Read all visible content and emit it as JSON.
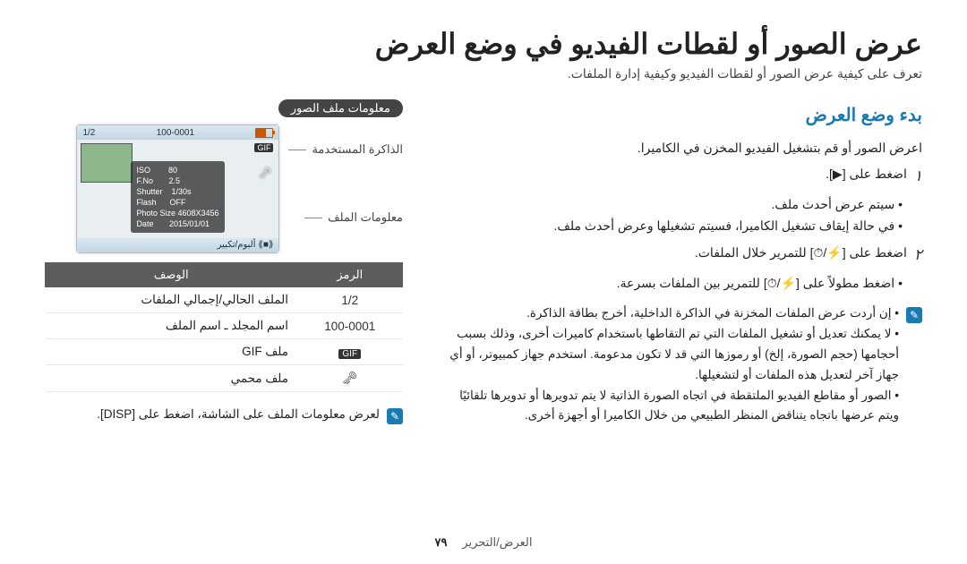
{
  "page": {
    "title": "عرض الصور أو لقطات الفيديو في وضع العرض",
    "intro": "تعرف على كيفية عرض الصور أو لقطات الفيديو وكيفية إدارة الملفات."
  },
  "playback": {
    "heading": "بدء وضع العرض",
    "lead": "اعرض الصور أو قم بتشغيل الفيديو المخزن في الكاميرا.",
    "step1": {
      "num": "١",
      "text": "اضغط على [▶]."
    },
    "step1_bullets": [
      "سيتم عرض أحدث ملف.",
      "في حالة إيقاف تشغيل الكاميرا، فسيتم تشغيلها وعرض أحدث ملف."
    ],
    "step2": {
      "num": "٢",
      "text": "اضغط على [⚡/⏱] للتمرير خلال الملفات."
    },
    "step2_bullets": [
      "اضغط مطولاً على [⚡/⏱] للتمرير بين الملفات بسرعة."
    ],
    "notes": [
      "إن أردت عرض الملفات المخزنة في الذاكرة الداخلية، أخرج بطاقة الذاكرة.",
      "لا يمكنك تعديل أو تشغيل الملفات التي تم التقاطها باستخدام كاميرات أخرى، وذلك بسبب أحجامها (حجم الصورة، إلخ) أو رموزها التي قد لا تكون مدعومة. استخدم جهاز كمبيوتر، أو أي جهاز آخر لتعديل هذه الملفات أو لتشغيلها.",
      "الصور أو مقاطع الفيديو الملتقطة في اتجاه الصورة الذاتية لا يتم تدويرها أو تدويرها تلقائيًا ويتم عرضها باتجاه يتناقض المنظر الطبيعي من خلال الكاميرا أو أجهزة أخرى."
    ]
  },
  "fileinfo": {
    "chip": "معلومات ملف الصور",
    "labels": {
      "memory": "الذاكرة المستخدمة",
      "info_block": "معلومات الملف"
    },
    "lcd": {
      "counter": "1/2",
      "folder": "100-0001",
      "gif": "GIF",
      "params": [
        "ISO        80",
        "F.No       2.5",
        "Shutter    1/30s",
        "Flash      OFF",
        "Photo Size 4608X3456",
        "Date       2015/01/01"
      ],
      "zoom_hint": "ألبوم/تكبير ⟪■⟫"
    },
    "table": {
      "headers": {
        "symbol": "الرمز",
        "desc": "الوصف"
      },
      "rows": [
        {
          "symbol": "1/2",
          "desc": "الملف الحالي/إجمالي الملفات"
        },
        {
          "symbol": "100-0001",
          "desc": "اسم المجلد ـ اسم الملف"
        },
        {
          "symbol_kind": "gif",
          "symbol": "GIF",
          "desc": "ملف GIF"
        },
        {
          "symbol_kind": "lock",
          "symbol": "🔒",
          "desc": "ملف محمي"
        }
      ]
    },
    "tip": "لعرض معلومات الملف على الشاشة، اضغط على [DISP]."
  },
  "footer": {
    "page": "٧٩",
    "section": "العرض/التحرير"
  }
}
